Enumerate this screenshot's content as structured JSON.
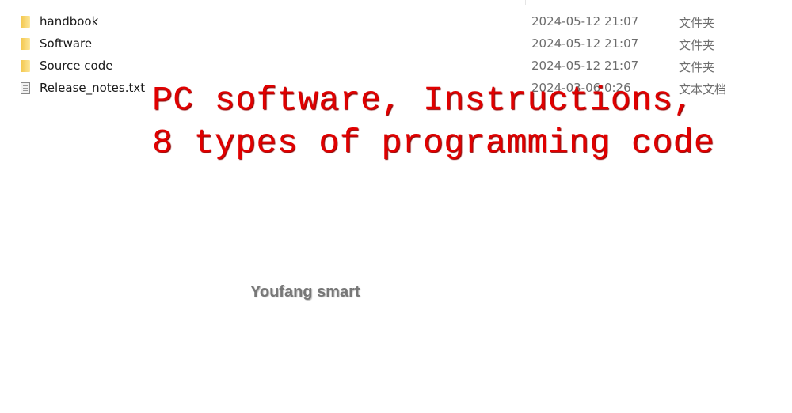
{
  "files": [
    {
      "name": "handbook",
      "date": "2024-05-12 21:07",
      "type": "文件夹",
      "icon": "folder-icon"
    },
    {
      "name": "Software",
      "date": "2024-05-12 21:07",
      "type": "文件夹",
      "icon": "folder-icon"
    },
    {
      "name": "Source code",
      "date": "2024-05-12 21:07",
      "type": "文件夹",
      "icon": "folder-icon"
    },
    {
      "name": "Release_notes.txt",
      "date": "2024-03-06 0:26",
      "type": "文本文档",
      "icon": "text-file-icon"
    }
  ],
  "overlay": {
    "line1": "PC software, Instructions,",
    "line2": "8 types of programming code",
    "color": "#e00000"
  },
  "watermark": "Youfang smart"
}
